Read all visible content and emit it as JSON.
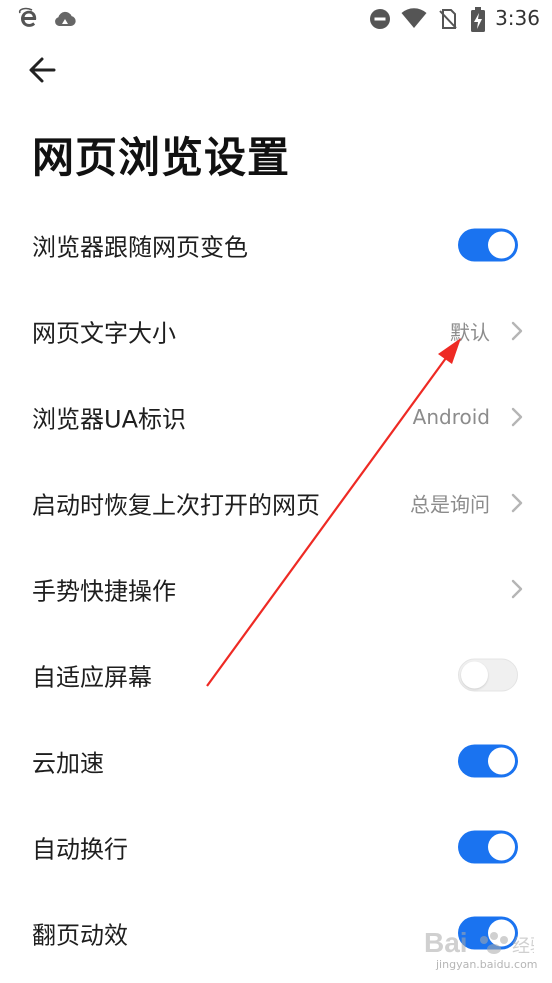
{
  "status_bar": {
    "time": "3:36",
    "left_icons": [
      "browser-e-icon",
      "cloud-icon"
    ],
    "right_icons": [
      "do-not-disturb-icon",
      "wifi-icon",
      "no-sim-icon",
      "battery-charging-icon"
    ]
  },
  "header": {
    "back_icon": "arrow-left-icon",
    "title": "网页浏览设置"
  },
  "settings": [
    {
      "label": "浏览器跟随网页变色",
      "type": "toggle",
      "on": true
    },
    {
      "label": "网页文字大小",
      "type": "link",
      "value": "默认"
    },
    {
      "label": "浏览器UA标识",
      "type": "link",
      "value": "Android"
    },
    {
      "label": "启动时恢复上次打开的网页",
      "type": "link",
      "value": "总是询问"
    },
    {
      "label": "手势快捷操作",
      "type": "link",
      "value": ""
    },
    {
      "label": "自适应屏幕",
      "type": "toggle",
      "on": false
    },
    {
      "label": "云加速",
      "type": "toggle",
      "on": true
    },
    {
      "label": "自动换行",
      "type": "toggle",
      "on": true
    },
    {
      "label": "翻页动效",
      "type": "toggle",
      "on": true
    }
  ],
  "colors": {
    "toggle_on": "#1a73f0",
    "toggle_off": "#f0f0f0",
    "annotation_arrow": "#ee2a24"
  },
  "watermark": {
    "logo": "Baidu经验",
    "url": "jingyan.baidu.com"
  }
}
